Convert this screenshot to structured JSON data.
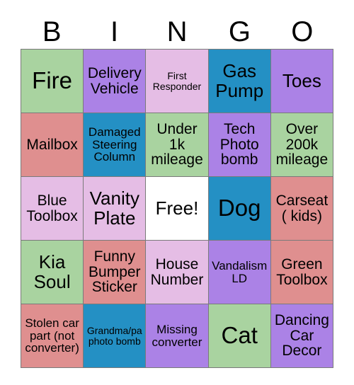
{
  "header": {
    "letters": [
      "B",
      "I",
      "N",
      "G",
      "O"
    ]
  },
  "colors": {
    "green": "#a9d3a0",
    "purple": "#ab82e6",
    "pink": "#e5bde5",
    "blue": "#2490c4",
    "salmon": "#df8f8f",
    "white": "#ffffff",
    "grid_line": "#7a7a7a",
    "text": "#000000",
    "background": "#ffffff"
  },
  "grid": {
    "rows": 5,
    "columns": 5,
    "cells": [
      [
        {
          "text": "Fire",
          "color": "#a9d3a0",
          "size": "fs-xl",
          "free": false
        },
        {
          "text": "Delivery\nVehicle",
          "color": "#ab82e6",
          "size": "fs-md",
          "free": false
        },
        {
          "text": "First\nResponder",
          "color": "#e5bde5",
          "size": "fs-xs",
          "free": false
        },
        {
          "text": "Gas\nPump",
          "color": "#2490c4",
          "size": "fs-lg",
          "free": false
        },
        {
          "text": "Toes",
          "color": "#ab82e6",
          "size": "fs-lg",
          "free": false
        }
      ],
      [
        {
          "text": "Mailbox",
          "color": "#df8f8f",
          "size": "fs-md",
          "free": false
        },
        {
          "text": "Damaged\nSteering\nColumn",
          "color": "#2490c4",
          "size": "fs-sm",
          "free": false
        },
        {
          "text": "Under\n1k\nmileage",
          "color": "#a9d3a0",
          "size": "fs-md",
          "free": false
        },
        {
          "text": "Tech\nPhoto\nbomb",
          "color": "#ab82e6",
          "size": "fs-md",
          "free": false
        },
        {
          "text": "Over\n200k\nmileage",
          "color": "#a9d3a0",
          "size": "fs-md",
          "free": false
        }
      ],
      [
        {
          "text": "Blue\nToolbox",
          "color": "#e5bde5",
          "size": "fs-md",
          "free": false
        },
        {
          "text": "Vanity\nPlate",
          "color": "#e5bde5",
          "size": "fs-lg",
          "free": false
        },
        {
          "text": "Free!",
          "color": "#ffffff",
          "size": "fs-lg",
          "free": true
        },
        {
          "text": "Dog",
          "color": "#2490c4",
          "size": "fs-xl",
          "free": false
        },
        {
          "text": "Carseat\n( kids)",
          "color": "#df8f8f",
          "size": "fs-md",
          "free": false
        }
      ],
      [
        {
          "text": "Kia\nSoul",
          "color": "#a9d3a0",
          "size": "fs-lg",
          "free": false
        },
        {
          "text": "Funny\nBumper\nSticker",
          "color": "#df8f8f",
          "size": "fs-md",
          "free": false
        },
        {
          "text": "House\nNumber",
          "color": "#e5bde5",
          "size": "fs-md",
          "free": false
        },
        {
          "text": "Vandalism\nLD",
          "color": "#ab82e6",
          "size": "fs-sm",
          "free": false
        },
        {
          "text": "Green\nToolbox",
          "color": "#df8f8f",
          "size": "fs-md",
          "free": false
        }
      ],
      [
        {
          "text": "Stolen car\npart (not\nconverter)",
          "color": "#df8f8f",
          "size": "fs-sm",
          "free": false
        },
        {
          "text": "Grandma/pa\nphoto bomb",
          "color": "#2490c4",
          "size": "fs-xs",
          "free": false
        },
        {
          "text": "Missing\nconverter",
          "color": "#ab82e6",
          "size": "fs-sm",
          "free": false
        },
        {
          "text": "Cat",
          "color": "#a9d3a0",
          "size": "fs-xl",
          "free": false
        },
        {
          "text": "Dancing\nCar\nDecor",
          "color": "#ab82e6",
          "size": "fs-md",
          "free": false
        }
      ]
    ]
  }
}
